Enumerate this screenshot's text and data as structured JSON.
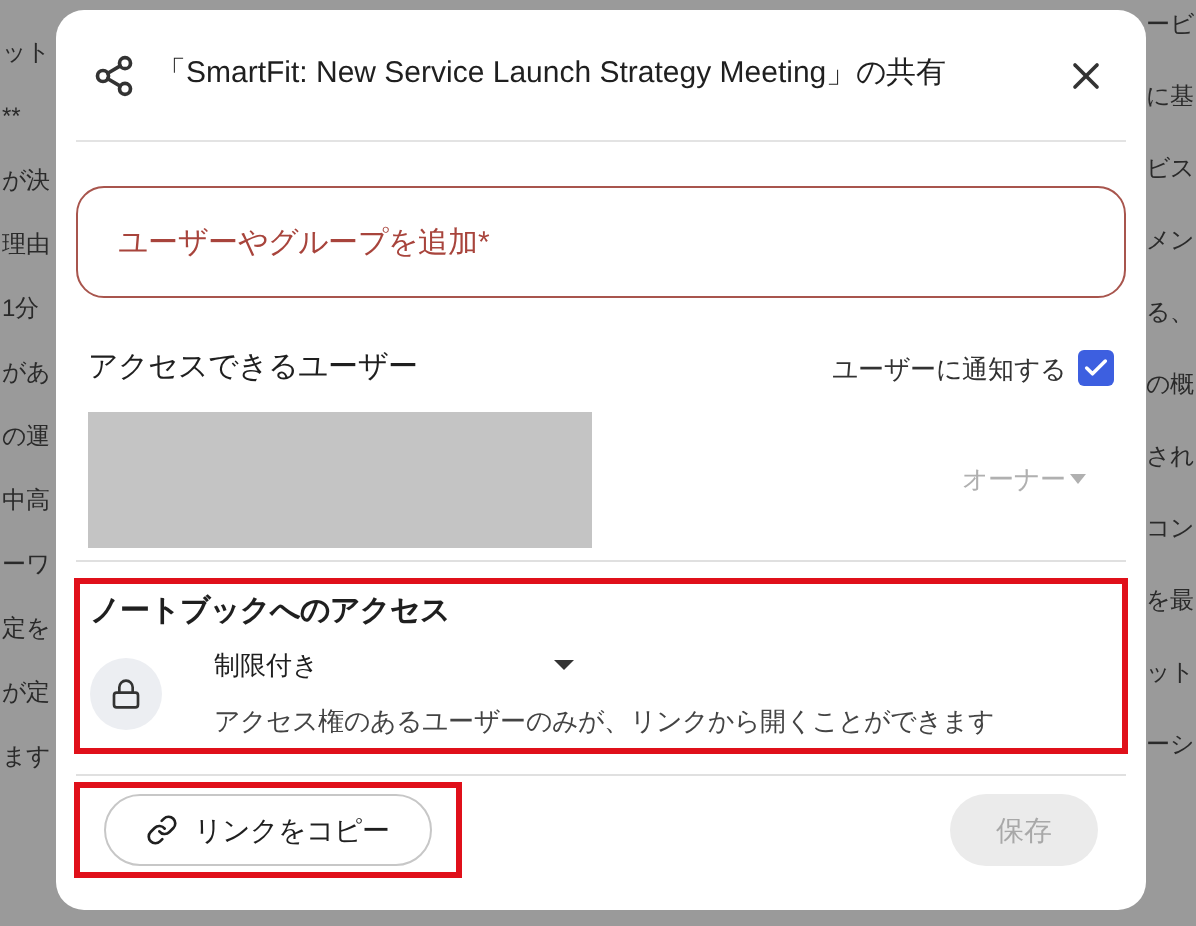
{
  "background": {
    "left_lines": [
      "ット",
      "**",
      "が決",
      "理由",
      "1分",
      "があ",
      "の運",
      "中高",
      "ーワ",
      "定を",
      "が定",
      "ます"
    ],
    "right_lines": [
      "ービ",
      "に基",
      "ビス",
      "メン",
      "る、",
      "の概",
      "され",
      "コン",
      "を最",
      "ット",
      "ーシ"
    ]
  },
  "dialog": {
    "title": "「SmartFit: New Service Launch Strategy Meeting」の共有",
    "add_field": {
      "placeholder": "ユーザーやグループを追加*"
    },
    "people_heading": "アクセスできるユーザー",
    "notify": {
      "label": "ユーザーに通知する",
      "checked": true
    },
    "owner_role": "オーナー",
    "access": {
      "heading": "ノートブックへのアクセス",
      "highlighted": true,
      "setting": "制限付き",
      "description": "アクセス権のあるユーザーのみが、リンクから開くことができます"
    },
    "copy_link": {
      "label": "リンクをコピー",
      "highlighted": true
    },
    "save": {
      "label": "保存",
      "disabled": true
    }
  }
}
